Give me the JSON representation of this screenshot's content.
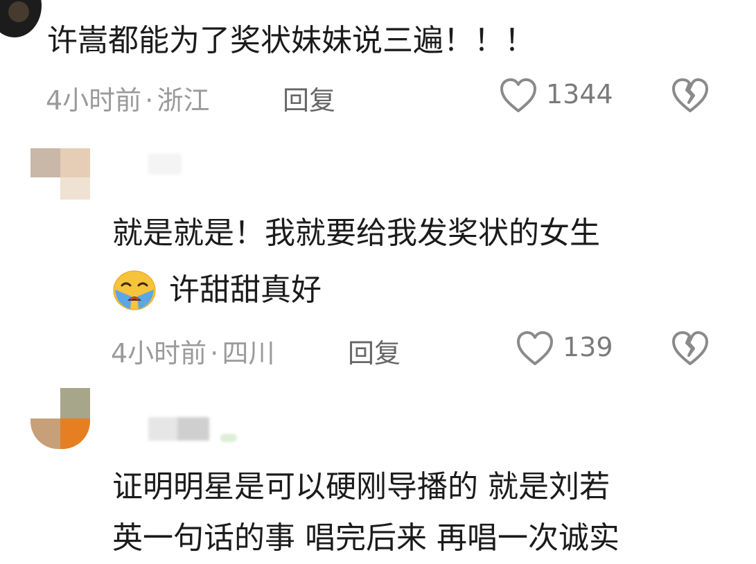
{
  "comments": [
    {
      "text_lines": [
        "许嵩都能为了奖状妹妹说三遍！！！"
      ],
      "time": "4小时前",
      "separator": "·",
      "location": "浙江",
      "reply_label": "回复",
      "likes": "1344"
    },
    {
      "text_lines": [
        "就是就是！我就要给我发奖状的女生",
        "许甜甜真好"
      ],
      "time": "4小时前",
      "separator": "·",
      "location": "四川",
      "reply_label": "回复",
      "likes": "139"
    },
    {
      "text_lines": [
        "证明明星是可以硬刚导播的 就是刘若",
        "英一句话的事 唱完后来 再唱一次诚实"
      ]
    }
  ],
  "icons": {
    "like": "heart-outline-icon",
    "dislike": "broken-heart-icon",
    "emoji": "loudly-crying-face-emoji"
  },
  "colors": {
    "meta_text": "#9a9a9a",
    "icon_stroke": "#8a8a8a"
  }
}
